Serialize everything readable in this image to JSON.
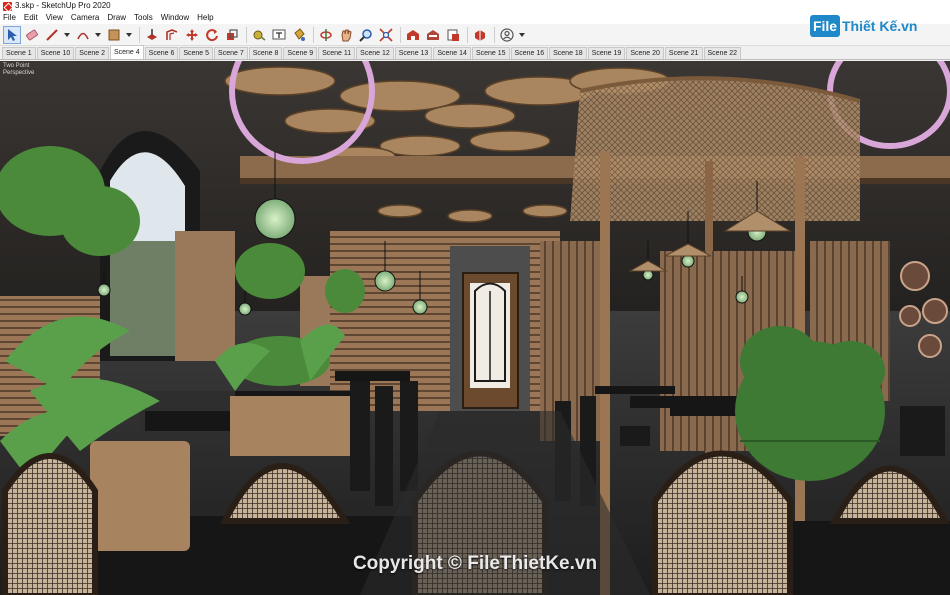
{
  "window": {
    "title": "3.skp - SketchUp Pro 2020"
  },
  "menu": [
    "File",
    "Edit",
    "View",
    "Camera",
    "Draw",
    "Tools",
    "Window",
    "Help"
  ],
  "toolbar": {
    "tools": [
      {
        "name": "select-tool-icon",
        "color": "#2b5fad"
      },
      {
        "name": "eraser-tool-icon",
        "color": "#e07a8c"
      },
      {
        "name": "line-tool-icon",
        "color": "#b1332b"
      },
      {
        "name": "arc-tool-icon",
        "color": "#b1332b"
      },
      {
        "name": "shape-tool-icon",
        "color": "#8a5a2b"
      },
      {
        "name": "push-pull-tool-icon",
        "color": "#b1332b"
      },
      {
        "name": "offset-tool-icon",
        "color": "#b1332b"
      },
      {
        "name": "move-tool-icon",
        "color": "#c0392b"
      },
      {
        "name": "rotate-tool-icon",
        "color": "#c0392b"
      },
      {
        "name": "scale-tool-icon",
        "color": "#c0392b"
      },
      {
        "name": "tape-measure-tool-icon",
        "color": "#6a7a2a"
      },
      {
        "name": "text-tool-icon",
        "color": "#555555"
      },
      {
        "name": "paint-bucket-tool-icon",
        "color": "#c08a1a"
      },
      {
        "name": "orbit-tool-icon",
        "color": "#3f7a3a"
      },
      {
        "name": "pan-tool-icon",
        "color": "#b1332b"
      },
      {
        "name": "zoom-tool-icon",
        "color": "#2b5fad"
      },
      {
        "name": "zoom-extents-tool-icon",
        "color": "#2b5fad"
      },
      {
        "name": "warehouse-icon",
        "color": "#c0392b"
      },
      {
        "name": "extension-warehouse-icon",
        "color": "#c0392b"
      },
      {
        "name": "send-to-layout-icon",
        "color": "#c0392b"
      },
      {
        "name": "extension-manager-icon",
        "color": "#c0392b"
      },
      {
        "name": "account-icon",
        "color": "#555555"
      }
    ]
  },
  "scenes": {
    "tabs": [
      "Scene 1",
      "Scene 10",
      "Scene 2",
      "Scene 4",
      "Scene 6",
      "Scene 5",
      "Scene 7",
      "Scene 8",
      "Scene 9",
      "Scene 11",
      "Scene 12",
      "Scene 13",
      "Scene 14",
      "Scene 15",
      "Scene 16",
      "Scene 18",
      "Scene 19",
      "Scene 20",
      "Scene 21",
      "Scene 22"
    ],
    "active": "Scene 4"
  },
  "viewport": {
    "label_top": "Two Point",
    "label_sub": "Perspective",
    "watermark": "Copyright © FileThietKe.vn"
  },
  "logo": {
    "badge": "File",
    "text": "Thiết Kế.vn"
  }
}
